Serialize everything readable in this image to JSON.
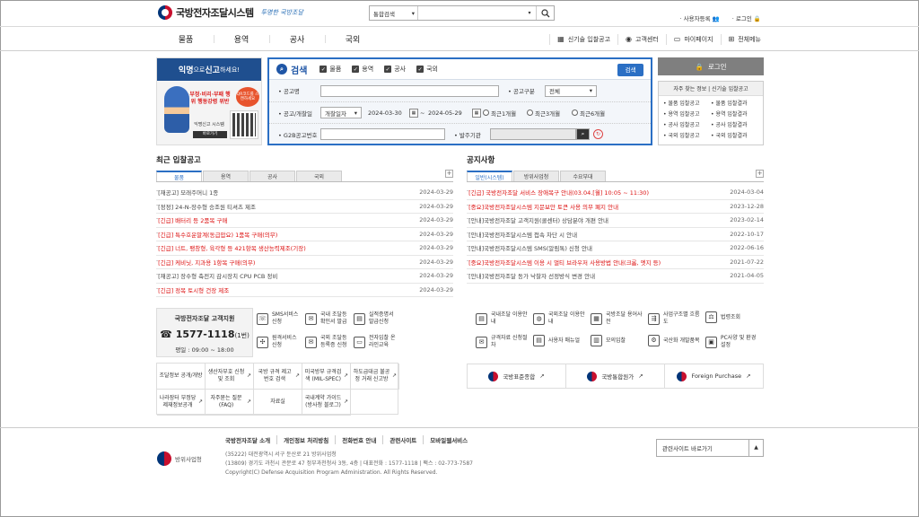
{
  "header": {
    "logo_title": "국방전자조달시스템",
    "logo_slogan": "투명한 국방조달",
    "search_scope": "통합검색",
    "search_placeholder": "",
    "util_register": "사용자등록",
    "util_login": "로그인"
  },
  "nav": {
    "main": [
      "물품",
      "용역",
      "공사",
      "국외"
    ],
    "right": [
      {
        "label": "신기술 입찰공고",
        "icon": "building-icon"
      },
      {
        "label": "고객센터",
        "icon": "headset-icon"
      },
      {
        "label": "마이페이지",
        "icon": "computer-icon"
      },
      {
        "label": "전체메뉴",
        "icon": "grid-menu-icon"
      }
    ]
  },
  "promo": {
    "title_a": "익명",
    "title_b": "으로 ",
    "title_c": "신고",
    "title_d": "하세요!",
    "red_text": "부정·비리·부패 행위 행동강령 위반",
    "badge": "QR코드를 스캔하세요",
    "small": "익명신고 시스템",
    "btn": "바로가기"
  },
  "search_panel": {
    "title": "검색",
    "categories": [
      "물품",
      "용역",
      "공사",
      "국외"
    ],
    "search_button": "검색",
    "notice_name_label": "공고명",
    "notice_type_label": "공고구분",
    "notice_type_value": "전체",
    "date_label": "공고/개찰일",
    "date_type": "개찰일자",
    "date_from": "2024-03-30",
    "date_sep": "~",
    "date_to": "2024-05-29",
    "radio_1": "최근1개월",
    "radio_2": "최근3개월",
    "radio_3": "최근6개월",
    "g2b_label": "G2B공고번호",
    "org_label": "발주기관"
  },
  "login": {
    "label": "로그인"
  },
  "quick": {
    "head": "자주 찾는 정보 | 신기술 입찰공고",
    "items": [
      "물품 입찰공고",
      "물품 입찰결과",
      "용역 입찰공고",
      "용역 입찰결과",
      "공사 입찰공고",
      "공사 입찰결과",
      "국외 입찰공고",
      "국외 입찰결과"
    ]
  },
  "recent": {
    "title": "최근 입찰공고",
    "tabs": [
      "물품",
      "용역",
      "공사",
      "국외"
    ],
    "items": [
      {
        "text": "[재공고] 모래주머니 1종",
        "date": "2024-03-29",
        "red": false
      },
      {
        "text": "[정정] 24-N-장수형 승조원 티셔츠 제조",
        "date": "2024-03-29",
        "red": false
      },
      {
        "text": "[긴급] 배터리 등 2품목 구매",
        "date": "2024-03-29",
        "red": true
      },
      {
        "text": "[긴급] 특수호운말계(동급압요) 1품목 구매(의무)",
        "date": "2024-03-29",
        "red": true
      },
      {
        "text": "[긴급] 너트, 팽창형, 육각형 등 421항목 생산능력제조(기장)",
        "date": "2024-03-29",
        "red": true
      },
      {
        "text": "[긴급] 케비닛, 지과용 1항목 구매(의무)",
        "date": "2024-03-29",
        "red": true
      },
      {
        "text": "[재공고] 장수형 축전지 감시장치 CPU PCB 정비",
        "date": "2024-03-29",
        "red": false
      },
      {
        "text": "[긴급] 정목 토시형 건장 제조",
        "date": "2024-03-29",
        "red": true
      }
    ]
  },
  "notices": {
    "title": "공지사항",
    "tabs": [
      "일반(시스템)",
      "방위사업청",
      "수요부대"
    ],
    "items": [
      {
        "text": "[긴급] 국방전자조달 서비스 장애복구 안내(03.04.[월] 10:05 ~ 11:30)",
        "date": "2024-03-04",
        "red": true
      },
      {
        "text": "[중요]국방전자조달시스템 지문보안 토큰 사용 의무 폐지 안내",
        "date": "2023-12-28",
        "red": true
      },
      {
        "text": "[안내]국방전자조달 고객지원(콜센터) 상담분야 개편 안내",
        "date": "2023-02-14",
        "red": false
      },
      {
        "text": "[안내]국방전자조달시스템 접속 차단 시 안내",
        "date": "2022-10-17",
        "red": false
      },
      {
        "text": "[안내]국방전자조달시스템 SMS(알림톡) 신청 안내",
        "date": "2022-06-16",
        "red": false
      },
      {
        "text": "[중요]국방전자조달시스템 이용 시 멀티 브라우저 사용방법 안내(크롬, 엣지 등)",
        "date": "2021-07-22",
        "red": true
      },
      {
        "text": "[안내]국방전자조달 동가 낙찰자 선정방식 변경 안내",
        "date": "2021-04-05",
        "red": false
      }
    ]
  },
  "customer": {
    "title": "국방전자조달 고객지원",
    "phone": "1577-1118",
    "phone_suffix": "(1번)",
    "hours": "평일 : 09:00 ~ 18:00"
  },
  "services_left": [
    {
      "label": "SMS서비스 신청",
      "icon": "phone-icon"
    },
    {
      "label": "국내 조달등 확인서 발급",
      "icon": "chat-icon"
    },
    {
      "label": "실적증명서 발급신청",
      "icon": "document-icon"
    },
    {
      "label": "원격서비스 신청",
      "icon": "remote-icon"
    },
    {
      "label": "국외 조달등 등록증 신청",
      "icon": "chat-icon"
    },
    {
      "label": "전자입찰 온라인교육",
      "icon": "monitor-icon"
    }
  ],
  "services_right": [
    {
      "label": "국내조달 이용안내",
      "icon": "manual-icon"
    },
    {
      "label": "국외조달 이용안내",
      "icon": "globe-icon"
    },
    {
      "label": "국방조달 용어사전",
      "icon": "book-icon"
    },
    {
      "label": "사업구조별 흐름도",
      "icon": "flow-icon"
    },
    {
      "label": "법령조회",
      "icon": "gavel-icon"
    },
    {
      "label": "규격자료 신청절차",
      "icon": "spec-icon"
    },
    {
      "label": "사용자 매뉴얼",
      "icon": "manual-icon"
    },
    {
      "label": "모의입찰",
      "icon": "test-icon"
    },
    {
      "label": "국산화 개발품목",
      "icon": "gear-icon"
    },
    {
      "label": "PC사양 및 환경설정",
      "icon": "pc-icon"
    }
  ],
  "links": [
    "조달정보 공개/개방",
    "생산자부호 신청 및 조회",
    "국방 규격 제고번호 검색",
    "미국방부 규격검색 (MIL-SPEC)",
    "하도급대금 불공정 거래 신고방",
    "나라장터 부정당 제재정보공개",
    "자주묻는 질문(FAQ)",
    "자료실",
    "국내계약 가이드 (방사청 블로그)",
    ""
  ],
  "banners": [
    "국방표준종합",
    "국방통합원가",
    "Foreign Purchase"
  ],
  "footer": {
    "links": [
      "국방전자조달 소개",
      "개인정보 처리방침",
      "전화번호 안내",
      "관련사이트",
      "모바일웹서비스"
    ],
    "org": "방위사업청",
    "addr1": "(35222) 대전광역시 서구 둔산로 21 방위사업청",
    "addr2": "(13809) 경기도 과천시 관문로 47 정부과천청사 3동, 4층  |  대표전화 : 1577-1118  |  팩스 : 02-773-7587",
    "copy": "Copyright(C) Defense Acquisition Program Administration. All Rights Reserved.",
    "related": "관련사이트 바로가기"
  }
}
